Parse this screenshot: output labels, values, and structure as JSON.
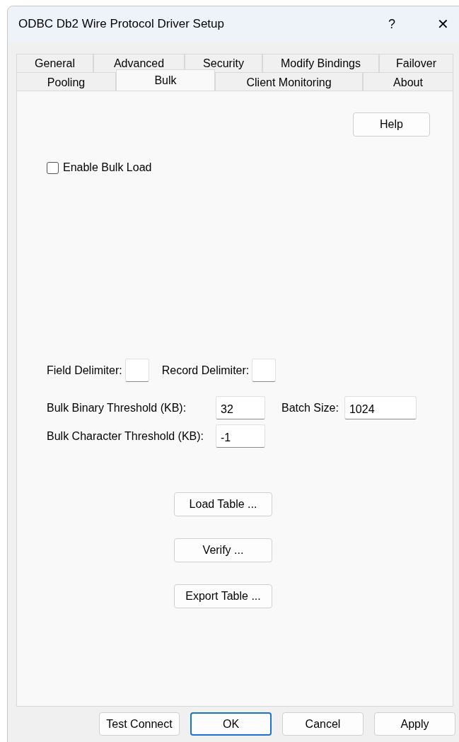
{
  "window": {
    "title": "ODBC Db2 Wire Protocol Driver Setup",
    "help_glyph": "?",
    "close_glyph": "✕"
  },
  "tab_rows": [
    [
      {
        "label": "General",
        "selected": false
      },
      {
        "label": "Advanced",
        "selected": false
      },
      {
        "label": "Security",
        "selected": false
      },
      {
        "label": "Modify Bindings",
        "selected": false
      },
      {
        "label": "Failover",
        "selected": false
      }
    ],
    [
      {
        "label": "Pooling",
        "selected": false
      },
      {
        "label": "Bulk",
        "selected": true
      },
      {
        "label": "Client Monitoring",
        "selected": false
      },
      {
        "label": "About",
        "selected": false
      }
    ]
  ],
  "help_button": "Help",
  "enable_bulk_load": {
    "label": "Enable Bulk Load",
    "checked": false
  },
  "delimiters": [
    {
      "label": "Field Delimiter:"
    },
    {
      "label": "Record Delimiter:"
    }
  ],
  "bulk_binary_threshold": {
    "label": "Bulk Binary Threshold (KB):",
    "value": "32"
  },
  "batch_size": {
    "label": "Batch Size:",
    "value": "1024"
  },
  "bulk_character_threshold": {
    "label": "Bulk Character Threshold (KB):",
    "value": "-1"
  },
  "actions": [
    "Load Table ...",
    "Verify ...",
    "Export Table ..."
  ],
  "footer_buttons": [
    {
      "label": "Test Connect",
      "default": false
    },
    {
      "label": "OK",
      "default": true
    },
    {
      "label": "Cancel",
      "default": false
    },
    {
      "label": "Apply",
      "default": false
    }
  ]
}
